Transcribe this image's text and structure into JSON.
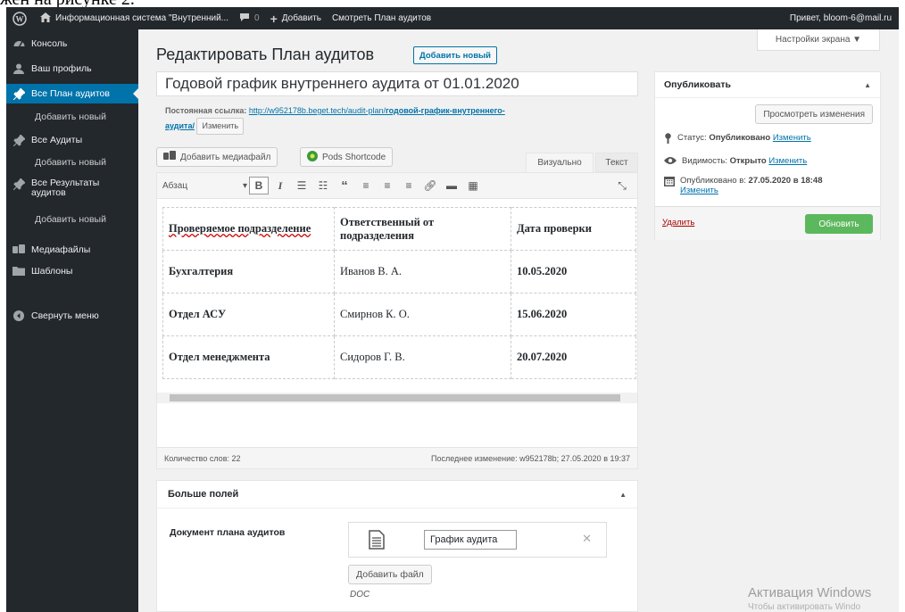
{
  "document_caption": "жен на рисунке 2.",
  "adminbar": {
    "site_name": "Информационная система \"Внутренний...",
    "comments_count": "0",
    "add_label": "Добавить",
    "view_label": "Смотреть План аудитов",
    "greeting": "Привет, bloom-6@mail.ru"
  },
  "sidebar": {
    "items": [
      {
        "label": "Консоль",
        "icon": "dashboard-icon"
      },
      {
        "label": "Ваш профиль",
        "icon": "user-icon"
      },
      {
        "label": "Все План аудитов",
        "icon": "pin-icon",
        "current": true
      },
      {
        "label": "Добавить новый",
        "sub": true
      },
      {
        "label": "Все Аудиты",
        "icon": "pin-icon"
      },
      {
        "label": "Добавить новый",
        "sub": true
      },
      {
        "label": "Все Результаты аудитов",
        "icon": "pin-icon"
      },
      {
        "label": "Добавить новый",
        "sub": true
      },
      {
        "label": "Медиафайлы",
        "icon": "media-icon"
      },
      {
        "label": "Шаблоны",
        "icon": "folder-icon"
      },
      {
        "label": "Свернуть меню",
        "icon": "collapse-icon"
      }
    ]
  },
  "screen_options": "Настройки экрана ▼",
  "page": {
    "title": "Редактировать План аудитов",
    "add_new": "Добавить новый",
    "post_title": "Годовой график внутреннего аудита от 01.01.2020",
    "permalink_label": "Постоянная ссылка:",
    "permalink_base": "http://w952178b.beget.tech/audit-plan/",
    "permalink_slug": "годовой-график-внутреннего-",
    "permalink_slug_end": "аудита/",
    "permalink_edit": "Изменить"
  },
  "editor": {
    "add_media": "Добавить медиафайл",
    "pods_shortcode": "Pods Shortcode",
    "tab_visual": "Визуально",
    "tab_text": "Текст",
    "format": "Абзац",
    "table": {
      "header": [
        "Проверяемое подразделение",
        "Ответственный от подразделения",
        "Дата проверки"
      ],
      "rows": [
        [
          "Бухгалтерия",
          "Иванов В. А.",
          "10.05.2020"
        ],
        [
          "Отдел АСУ",
          "Смирнов К. О.",
          "15.06.2020"
        ],
        [
          "Отдел менеджмента",
          "Сидоров Г. В.",
          "20.07.2020"
        ]
      ]
    },
    "word_count": "Количество слов: 22",
    "last_edit": "Последнее изменение: w952178b; 27.05.2020 в 19:37"
  },
  "more_fields": {
    "title": "Больше полей",
    "doc_label": "Документ плана аудитов",
    "file_name": "График аудита",
    "add_file": "Добавить файл",
    "file_type": "DOC"
  },
  "publish": {
    "title": "Опубликовать",
    "preview": "Просмотреть изменения",
    "status_label": "Статус:",
    "status_value": "Опубликовано",
    "status_edit": "Изменить",
    "visibility_label": "Видимость:",
    "visibility_value": "Открыто",
    "visibility_edit": "Изменить",
    "published_label": "Опубликовано в:",
    "published_value": "27.05.2020 в 18:48",
    "published_edit": "Изменить",
    "delete": "Удалить",
    "update": "Обновить"
  },
  "watermark": {
    "title": "Активация Windows",
    "subtitle": "Чтобы активировать Windo"
  },
  "colors": {
    "adminbar_bg": "#23282d",
    "accent": "#0073aa",
    "update_button": "#5cb85c",
    "content_bg": "#f1f1f1"
  }
}
